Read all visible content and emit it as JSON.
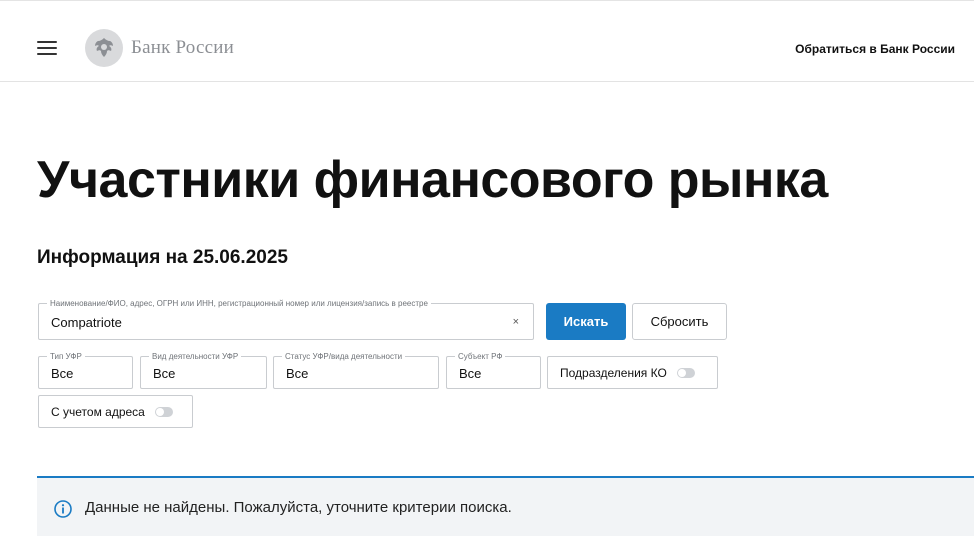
{
  "header": {
    "logo_text": "Банк России",
    "contact_link": "Обратиться в Банк России"
  },
  "main": {
    "title": "Участники финансового рынка",
    "info_date": "Информация на 25.06.2025"
  },
  "search": {
    "legend": "Наименование/ФИО, адрес, ОГРН или ИНН, регистрационный номер или лицензия/запись в реестре",
    "value": "Compatriote",
    "clear_glyph": "×",
    "search_button": "Искать",
    "reset_button": "Сбросить"
  },
  "filters": [
    {
      "legend": "Тип УФР",
      "value": "Все"
    },
    {
      "legend": "Вид деятельности УФР",
      "value": "Все"
    },
    {
      "legend": "Статус УФР/вида деятельности",
      "value": "Все"
    },
    {
      "legend": "Субъект РФ",
      "value": "Все"
    }
  ],
  "toggles": {
    "branches": {
      "label": "Подразделения КО",
      "on": false
    },
    "address": {
      "label": "С учетом адреса",
      "on": false
    }
  },
  "notice": {
    "text": "Данные не найдены. Пожалуйста, уточните критерии поиска.",
    "icon": "info-icon"
  },
  "colors": {
    "accent": "#1a7bc4",
    "notice_bg": "#f2f4f6",
    "logo_gray": "#8c8f94"
  }
}
